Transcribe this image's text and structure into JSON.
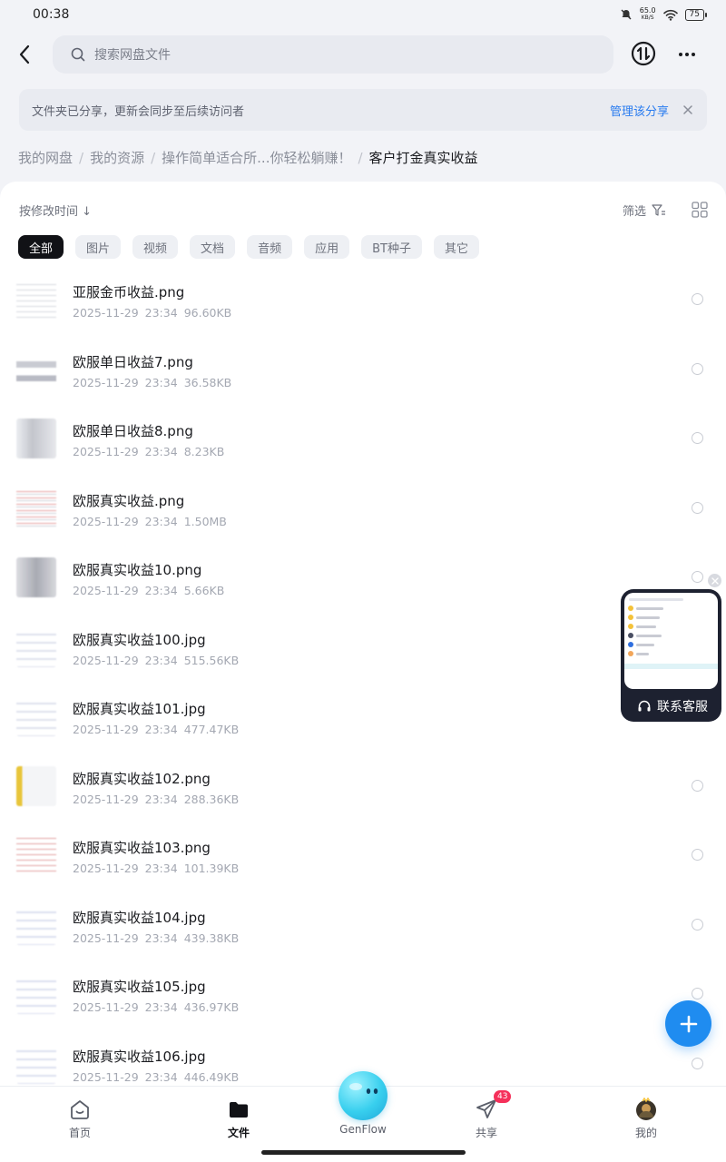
{
  "status_bar": {
    "time": "00:38",
    "net_speed_value": "65.0",
    "net_speed_unit": "KB/S",
    "battery": "75"
  },
  "search": {
    "placeholder": "搜索网盘文件"
  },
  "notice": {
    "text": "文件夹已分享，更新会同步至后续访问者",
    "action": "管理该分享"
  },
  "breadcrumb": {
    "items": [
      "我的网盘",
      "我的资源",
      "操作简单适合所...你轻松躺赚！"
    ],
    "separator": "/",
    "current": "客户打金真实收益"
  },
  "toolbar": {
    "sort_label": "按修改时间 ↓",
    "filter_label": "筛选"
  },
  "chips": [
    {
      "label": "全部",
      "active": true
    },
    {
      "label": "图片",
      "active": false
    },
    {
      "label": "视频",
      "active": false
    },
    {
      "label": "文档",
      "active": false
    },
    {
      "label": "音频",
      "active": false
    },
    {
      "label": "应用",
      "active": false
    },
    {
      "label": "BT种子",
      "active": false
    },
    {
      "label": "其它",
      "active": false
    }
  ],
  "files": [
    {
      "name": "亚服金币收益.png",
      "date": "2025-11-29",
      "time": "23:34",
      "size": "96.60KB"
    },
    {
      "name": "欧服单日收益7.png",
      "date": "2025-11-29",
      "time": "23:34",
      "size": "36.58KB"
    },
    {
      "name": "欧服单日收益8.png",
      "date": "2025-11-29",
      "time": "23:34",
      "size": "8.23KB"
    },
    {
      "name": "欧服真实收益.png",
      "date": "2025-11-29",
      "time": "23:34",
      "size": "1.50MB"
    },
    {
      "name": "欧服真实收益10.png",
      "date": "2025-11-29",
      "time": "23:34",
      "size": "5.66KB"
    },
    {
      "name": "欧服真实收益100.jpg",
      "date": "2025-11-29",
      "time": "23:34",
      "size": "515.56KB"
    },
    {
      "name": "欧服真实收益101.jpg",
      "date": "2025-11-29",
      "time": "23:34",
      "size": "477.47KB"
    },
    {
      "name": "欧服真实收益102.png",
      "date": "2025-11-29",
      "time": "23:34",
      "size": "288.36KB"
    },
    {
      "name": "欧服真实收益103.png",
      "date": "2025-11-29",
      "time": "23:34",
      "size": "101.39KB"
    },
    {
      "name": "欧服真实收益104.jpg",
      "date": "2025-11-29",
      "time": "23:34",
      "size": "439.38KB"
    },
    {
      "name": "欧服真实收益105.jpg",
      "date": "2025-11-29",
      "time": "23:34",
      "size": "436.97KB"
    },
    {
      "name": "欧服真实收益106.jpg",
      "date": "2025-11-29",
      "time": "23:34",
      "size": "446.49KB"
    }
  ],
  "service_widget": {
    "label": "联系客服"
  },
  "bottom_nav": {
    "items": [
      {
        "label": "首页",
        "icon": "home-icon",
        "active": false
      },
      {
        "label": "文件",
        "icon": "folder-icon",
        "active": true
      },
      {
        "label": "GenFlow",
        "icon": "genflow-icon",
        "active": false
      },
      {
        "label": "共享",
        "icon": "send-icon",
        "active": false,
        "badge": "43"
      },
      {
        "label": "我的",
        "icon": "avatar",
        "active": false
      }
    ]
  },
  "colors": {
    "accent": "#2a7cf0",
    "fab": "#1f8cf0",
    "badge": "#f5305a",
    "active_chip": "#111216"
  }
}
